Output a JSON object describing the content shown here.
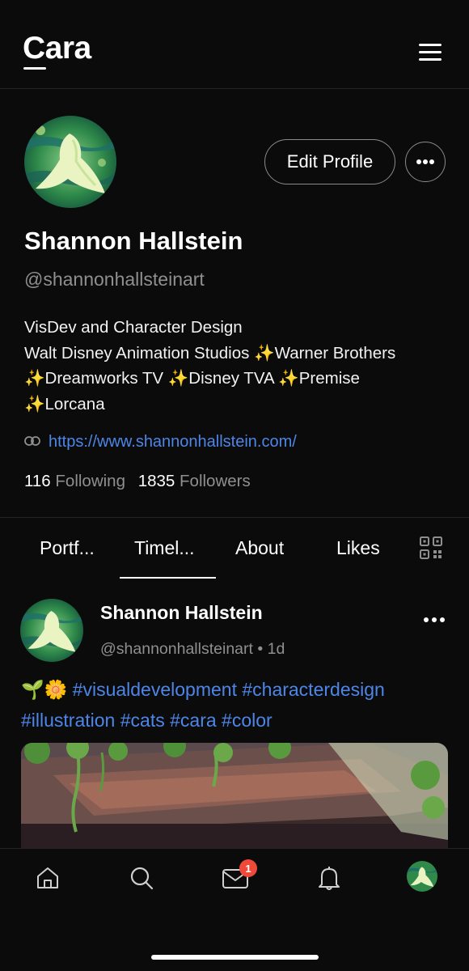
{
  "header": {
    "logo": "Cara",
    "menu_icon": "hamburger-menu-icon"
  },
  "profile": {
    "name": "Shannon Hallstein",
    "handle": "@shannonhallsteinart",
    "edit_button": "Edit Profile",
    "more_icon": "more-horizontal-icon",
    "bio": [
      "VisDev and Character Design",
      "Walt Disney Animation Studios ✨Warner Brothers",
      "✨Dreamworks TV ✨Disney TVA ✨Premise",
      "✨Lorcana"
    ],
    "website": "https://www.shannonhallstein.com/",
    "following_count": "116",
    "following_label": "Following",
    "followers_count": "1835",
    "followers_label": "Followers"
  },
  "tabs": [
    {
      "label": "Portf..."
    },
    {
      "label": "Timel...",
      "active": true
    },
    {
      "label": "About"
    },
    {
      "label": "Likes"
    }
  ],
  "post": {
    "author": "Shannon Hallstein",
    "handle": "@shannonhallsteinart",
    "separator": "•",
    "time": "1d",
    "emoji": "🌱🌼",
    "tags": [
      "#visualdevelopment",
      "#characterdesign",
      "#illustration",
      "#cats",
      "#cara",
      "#color"
    ]
  },
  "bottom_nav": {
    "items": [
      "home-icon",
      "search-icon",
      "inbox-icon",
      "bell-icon",
      "profile-avatar"
    ],
    "inbox_badge": "1"
  },
  "colors": {
    "background": "#0b0b0b",
    "link": "#4d86e8",
    "muted": "#8f8f8f",
    "badge": "#ef4a39"
  }
}
